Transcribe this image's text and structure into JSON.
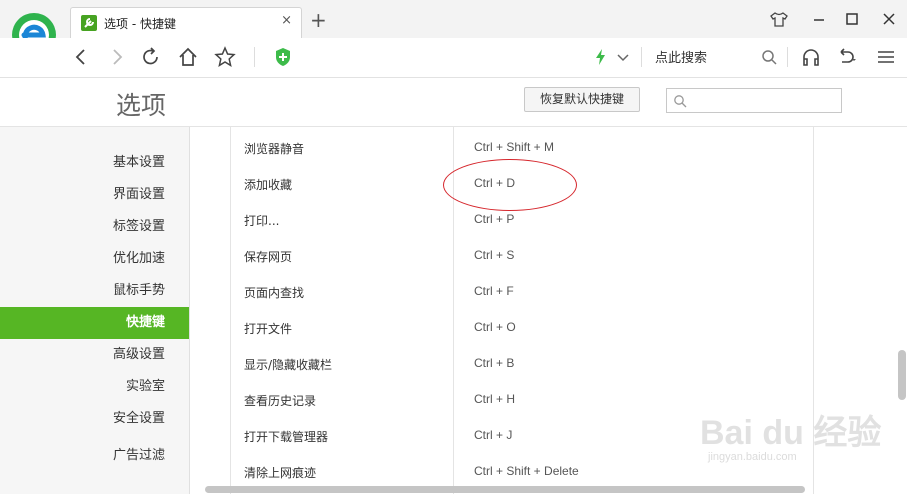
{
  "browser": {
    "tab_title": "选项 - 快捷键",
    "tab_close": "×",
    "new_tab": "+",
    "search_label": "点此搜索",
    "accent": "#56b624"
  },
  "icons": [
    "browser-logo-icon",
    "settings-icon",
    "close-icon",
    "plus-icon",
    "shirt-icon",
    "minimize-icon",
    "maximize-icon",
    "window-close-icon",
    "back-icon",
    "forward-icon",
    "refresh-icon",
    "home-icon",
    "star-icon",
    "shield-plus-icon",
    "lightning-icon",
    "chevron-down-icon",
    "search-icon",
    "headphones-icon",
    "undo-icon",
    "menu-icon"
  ],
  "page": {
    "title": "选项",
    "reset_button": "恢复默认快捷键",
    "search_placeholder": ""
  },
  "nav": {
    "items": [
      {
        "label": "基本设置",
        "active": false
      },
      {
        "label": "界面设置",
        "active": false
      },
      {
        "label": "标签设置",
        "active": false
      },
      {
        "label": "优化加速",
        "active": false
      },
      {
        "label": "鼠标手势",
        "active": false
      },
      {
        "label": "快捷键",
        "active": true
      },
      {
        "label": "高级设置",
        "active": false
      },
      {
        "label": "实验室",
        "active": false
      },
      {
        "label": "安全设置",
        "active": false
      },
      {
        "label": "广告过滤",
        "active": false
      }
    ]
  },
  "shortcuts": [
    {
      "action": "浏览器静音",
      "keys": "Ctrl + Shift + M"
    },
    {
      "action": "添加收藏",
      "keys": "Ctrl + D"
    },
    {
      "action": "打印...",
      "keys": "Ctrl + P"
    },
    {
      "action": "保存网页",
      "keys": "Ctrl + S"
    },
    {
      "action": "页面内查找",
      "keys": "Ctrl + F"
    },
    {
      "action": "打开文件",
      "keys": "Ctrl + O"
    },
    {
      "action": "显示/隐藏收藏栏",
      "keys": "Ctrl + B"
    },
    {
      "action": "查看历史记录",
      "keys": "Ctrl + H"
    },
    {
      "action": "打开下载管理器",
      "keys": "Ctrl + J"
    },
    {
      "action": "清除上网痕迹",
      "keys": "Ctrl + Shift + Delete"
    }
  ],
  "watermark": {
    "main": "Bai du 经验",
    "sub": "jingyan.baidu.com"
  }
}
